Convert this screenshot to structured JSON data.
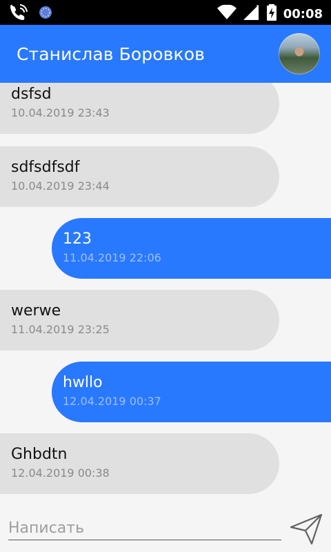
{
  "status_bar": {
    "time": "00:08",
    "icons": [
      "phone-wifi-icon",
      "sync-icon",
      "wifi-icon",
      "signal-icon",
      "battery-charging-icon"
    ]
  },
  "header": {
    "title": "Станислав Боровков",
    "avatar_icon": "avatar"
  },
  "colors": {
    "accent": "#2979ff",
    "incoming_bubble": "#e0e0e0",
    "background": "#f5f5f5"
  },
  "messages": [
    {
      "direction": "in",
      "text": "dsfsd",
      "time": "10.04.2019 23:43"
    },
    {
      "direction": "in",
      "text": "sdfsdfsdf",
      "time": "10.04.2019 23:44"
    },
    {
      "direction": "out",
      "text": "123",
      "time": "11.04.2019 22:06"
    },
    {
      "direction": "in",
      "text": "werwe",
      "time": "11.04.2019 23:25"
    },
    {
      "direction": "out",
      "text": "hwllo",
      "time": "12.04.2019 00:37"
    },
    {
      "direction": "in",
      "text": "Ghbdtn",
      "time": "12.04.2019 00:38"
    }
  ],
  "composer": {
    "placeholder": "Написать",
    "value": "",
    "send_icon": "send-icon"
  }
}
